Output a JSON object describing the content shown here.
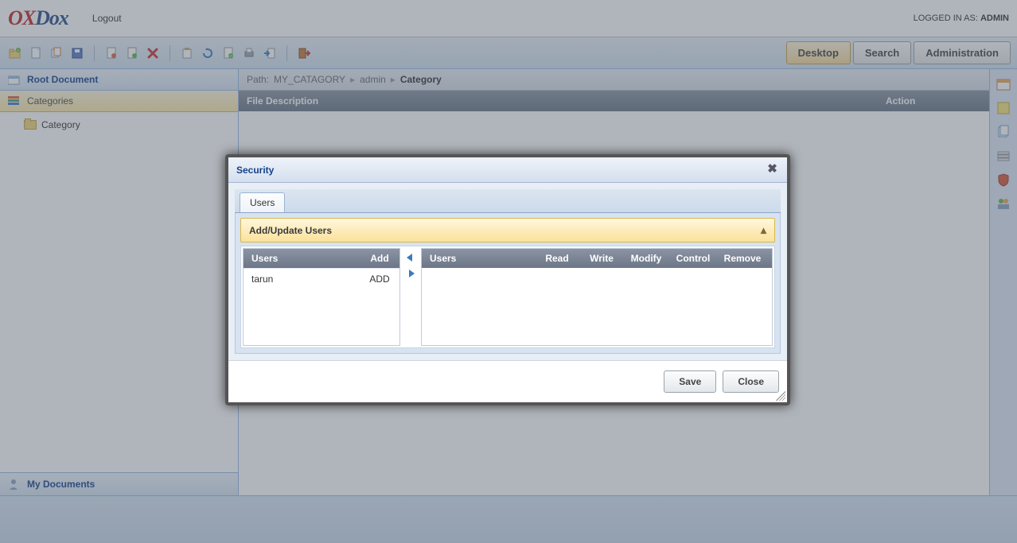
{
  "header": {
    "logo_ox": "OX",
    "logo_dox": "Dox",
    "logout": "Logout",
    "logged_in_prefix": "LOGGED IN AS: ",
    "logged_in_user": "ADMIN"
  },
  "topButtons": {
    "desktop": "Desktop",
    "search": "Search",
    "administration": "Administration"
  },
  "sidebar": {
    "root": "Root Document",
    "categories": "Categories",
    "tree_item": "Category",
    "my_documents": "My Documents"
  },
  "breadcrumb": {
    "label": "Path:",
    "seg1": "MY_CATAGORY",
    "seg2": "admin",
    "seg3": "Category"
  },
  "grid": {
    "col_file": "File Description",
    "col_action": "Action"
  },
  "modal": {
    "title": "Security",
    "tab_users": "Users",
    "section_title": "Add/Update Users",
    "left_table": {
      "col_users": "Users",
      "col_add": "Add",
      "rows": [
        {
          "user": "tarun",
          "add": "ADD"
        }
      ]
    },
    "right_table": {
      "col_users": "Users",
      "col_read": "Read",
      "col_write": "Write",
      "col_modify": "Modify",
      "col_control": "Control",
      "col_remove": "Remove"
    },
    "save": "Save",
    "close": "Close"
  }
}
